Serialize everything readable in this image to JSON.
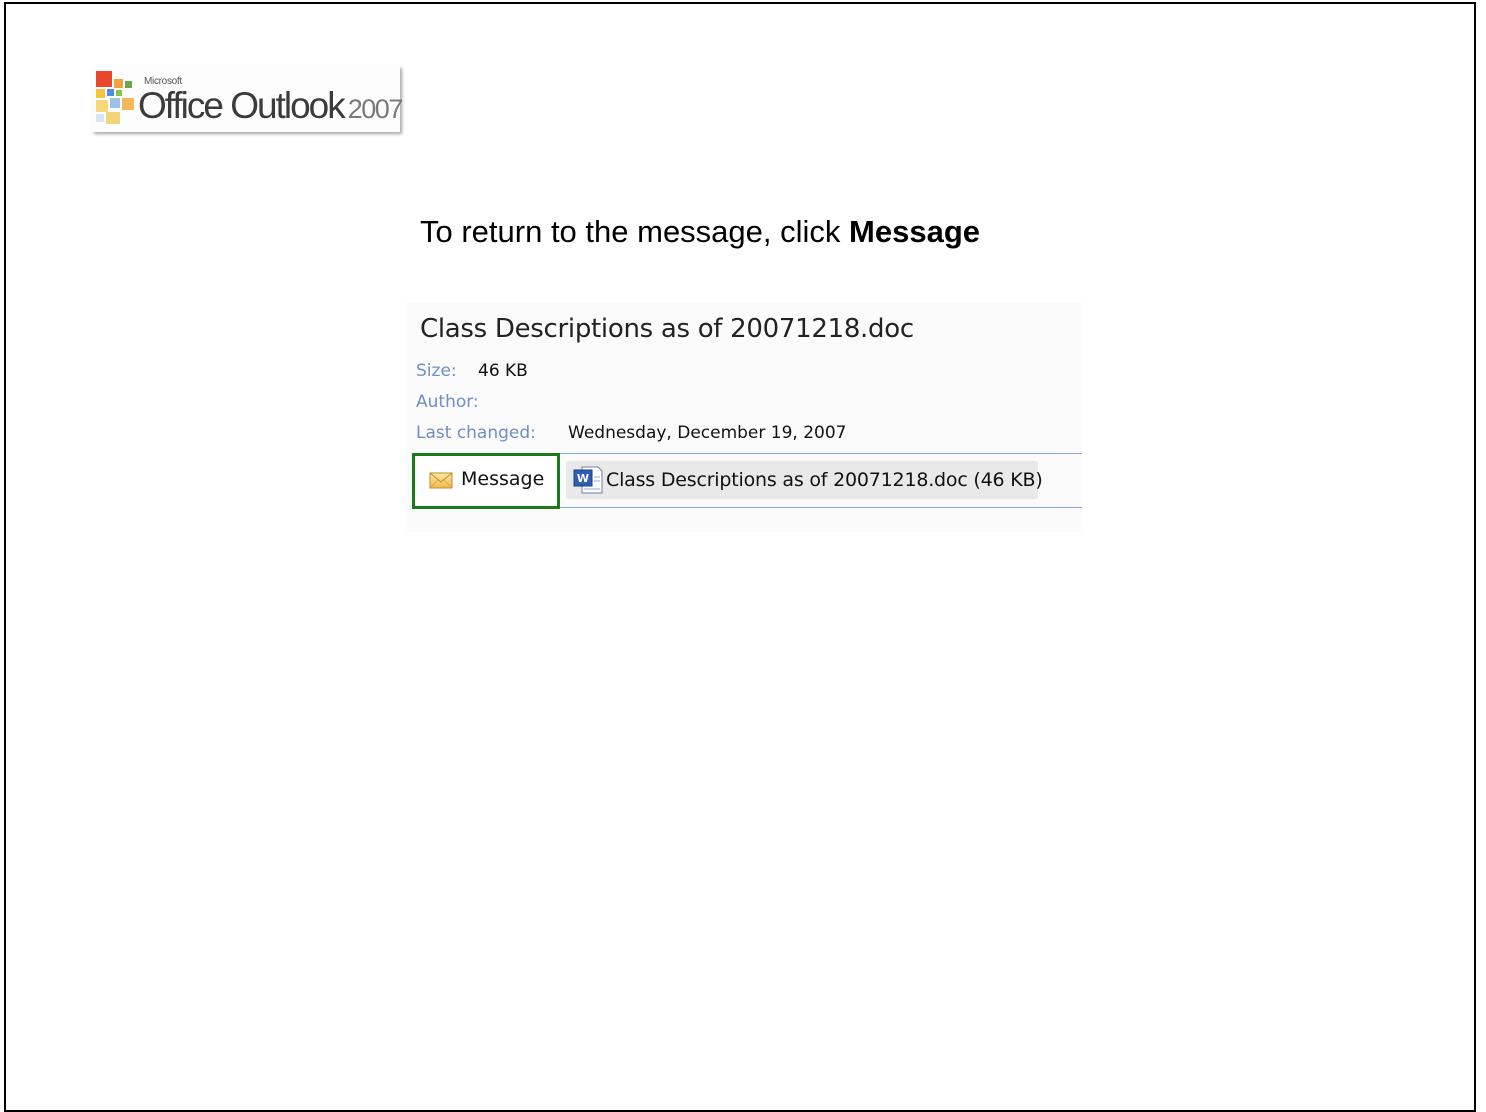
{
  "logo": {
    "microsoft": "Microsoft",
    "product": "Office Outlook",
    "year": "2007"
  },
  "instruction": {
    "prefix": "To return to the message, click ",
    "emphasis": "Message"
  },
  "attachment": {
    "title": "Class Descriptions as of 20071218.doc",
    "properties": {
      "size_label": "Size:",
      "size_value": "46 KB",
      "author_label": "Author:",
      "author_value": "",
      "changed_label": "Last changed:",
      "changed_value": "Wednesday, December 19, 2007"
    },
    "buttons": {
      "message_label": "Message",
      "attachment_label": "Class Descriptions as of 20071218.doc (46 KB)"
    }
  },
  "colors": {
    "highlight_border": "#1a7a1a",
    "property_label": "#6e8fc4",
    "separator": "#8ea8d8"
  },
  "icons": {
    "logo": "office-logo-icon",
    "message": "envelope-icon",
    "attachment": "word-document-icon"
  }
}
